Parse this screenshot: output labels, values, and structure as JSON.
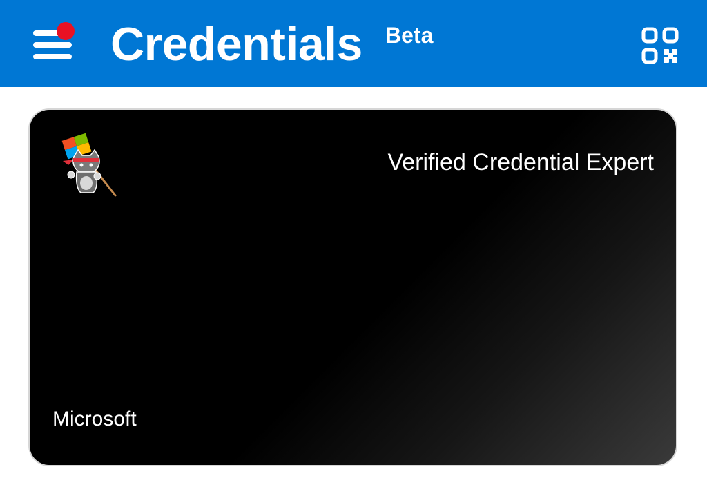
{
  "header": {
    "title": "Credentials",
    "badge": "Beta",
    "menu_icon": "hamburger-menu-icon",
    "notification_icon": "notification-dot",
    "scan_icon": "qr-code-icon",
    "background_color": "#0077d4",
    "notification_color": "#e81123"
  },
  "cards": [
    {
      "title": "Verified Credential Expert",
      "issuer": "Microsoft",
      "logo_icon": "ninja-cat-flag-logo",
      "background_color": "#000000"
    }
  ]
}
